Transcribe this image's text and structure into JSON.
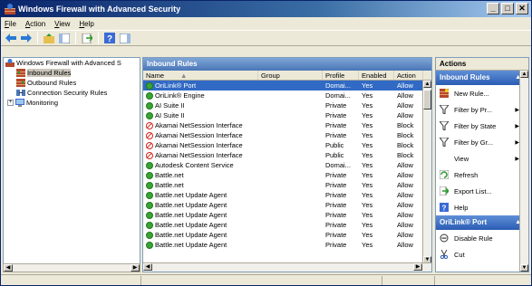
{
  "window": {
    "title": "Windows Firewall with Advanced Security"
  },
  "titlebar_buttons": {
    "minimize": "_",
    "maximize": "□",
    "close": "✕"
  },
  "menu": [
    {
      "label": "File",
      "accel": "F",
      "rest": "ile"
    },
    {
      "label": "Action",
      "accel": "A",
      "rest": "ction"
    },
    {
      "label": "View",
      "accel": "V",
      "rest": "iew"
    },
    {
      "label": "Help",
      "accel": "H",
      "rest": "elp"
    }
  ],
  "tree": {
    "root": "Windows Firewall with Advanced S",
    "items": [
      {
        "label": "Inbound Rules",
        "selected": true
      },
      {
        "label": "Outbound Rules",
        "selected": false
      },
      {
        "label": "Connection Security Rules",
        "selected": false
      },
      {
        "label": "Monitoring",
        "selected": false,
        "expander": "+"
      }
    ]
  },
  "main": {
    "header": "Inbound Rules",
    "columns": [
      "Name",
      "Group",
      "Profile",
      "Enabled",
      "Action"
    ],
    "rows": [
      {
        "name": "OriLink® Port",
        "group": "",
        "profile": "Domai...",
        "enabled": "Yes",
        "action": "Allow",
        "icon": "allow",
        "selected": true
      },
      {
        "name": "OriLink® Engine",
        "group": "",
        "profile": "Domai...",
        "enabled": "Yes",
        "action": "Allow",
        "icon": "allow"
      },
      {
        "name": "AI Suite II",
        "group": "",
        "profile": "Private",
        "enabled": "Yes",
        "action": "Allow",
        "icon": "allow"
      },
      {
        "name": "AI Suite II",
        "group": "",
        "profile": "Private",
        "enabled": "Yes",
        "action": "Allow",
        "icon": "allow"
      },
      {
        "name": "Akamai NetSession Interface",
        "group": "",
        "profile": "Private",
        "enabled": "Yes",
        "action": "Block",
        "icon": "block"
      },
      {
        "name": "Akamai NetSession Interface",
        "group": "",
        "profile": "Private",
        "enabled": "Yes",
        "action": "Block",
        "icon": "block"
      },
      {
        "name": "Akamai NetSession Interface",
        "group": "",
        "profile": "Public",
        "enabled": "Yes",
        "action": "Block",
        "icon": "block"
      },
      {
        "name": "Akamai NetSession Interface",
        "group": "",
        "profile": "Public",
        "enabled": "Yes",
        "action": "Block",
        "icon": "block"
      },
      {
        "name": "Autodesk Content Service",
        "group": "",
        "profile": "Domai...",
        "enabled": "Yes",
        "action": "Allow",
        "icon": "allow"
      },
      {
        "name": "Battle.net",
        "group": "",
        "profile": "Private",
        "enabled": "Yes",
        "action": "Allow",
        "icon": "allow"
      },
      {
        "name": "Battle.net",
        "group": "",
        "profile": "Private",
        "enabled": "Yes",
        "action": "Allow",
        "icon": "allow"
      },
      {
        "name": "Battle.net Update Agent",
        "group": "",
        "profile": "Private",
        "enabled": "Yes",
        "action": "Allow",
        "icon": "allow"
      },
      {
        "name": "Battle.net Update Agent",
        "group": "",
        "profile": "Private",
        "enabled": "Yes",
        "action": "Allow",
        "icon": "allow"
      },
      {
        "name": "Battle.net Update Agent",
        "group": "",
        "profile": "Private",
        "enabled": "Yes",
        "action": "Allow",
        "icon": "allow"
      },
      {
        "name": "Battle.net Update Agent",
        "group": "",
        "profile": "Private",
        "enabled": "Yes",
        "action": "Allow",
        "icon": "allow"
      },
      {
        "name": "Battle.net Update Agent",
        "group": "",
        "profile": "Private",
        "enabled": "Yes",
        "action": "Allow",
        "icon": "allow"
      },
      {
        "name": "Battle.net Update Agent",
        "group": "",
        "profile": "Private",
        "enabled": "Yes",
        "action": "Allow",
        "icon": "allow"
      }
    ]
  },
  "actions": {
    "title": "Actions",
    "section1": "Inbound Rules",
    "items1": [
      {
        "label": "New Rule...",
        "icon": "new-rule-icon",
        "arrow": false
      },
      {
        "label": "Filter by Pr...",
        "icon": "filter-icon",
        "arrow": true
      },
      {
        "label": "Filter by State",
        "icon": "filter-icon",
        "arrow": true
      },
      {
        "label": "Filter by Gr...",
        "icon": "filter-icon",
        "arrow": true
      },
      {
        "label": "View",
        "icon": "",
        "arrow": true
      },
      {
        "label": "Refresh",
        "icon": "refresh-icon",
        "arrow": false
      },
      {
        "label": "Export List...",
        "icon": "export-icon",
        "arrow": false
      },
      {
        "label": "Help",
        "icon": "help-icon",
        "arrow": false
      }
    ],
    "section2": "OriLink® Port",
    "items2": [
      {
        "label": "Disable Rule",
        "icon": "disable-icon",
        "arrow": false
      },
      {
        "label": "Cut",
        "icon": "cut-icon",
        "arrow": false
      }
    ]
  },
  "colors": {
    "allow": "#3aa435",
    "block": "#d6261c",
    "selection": "#316ac5",
    "section": "#2a5cb4"
  }
}
